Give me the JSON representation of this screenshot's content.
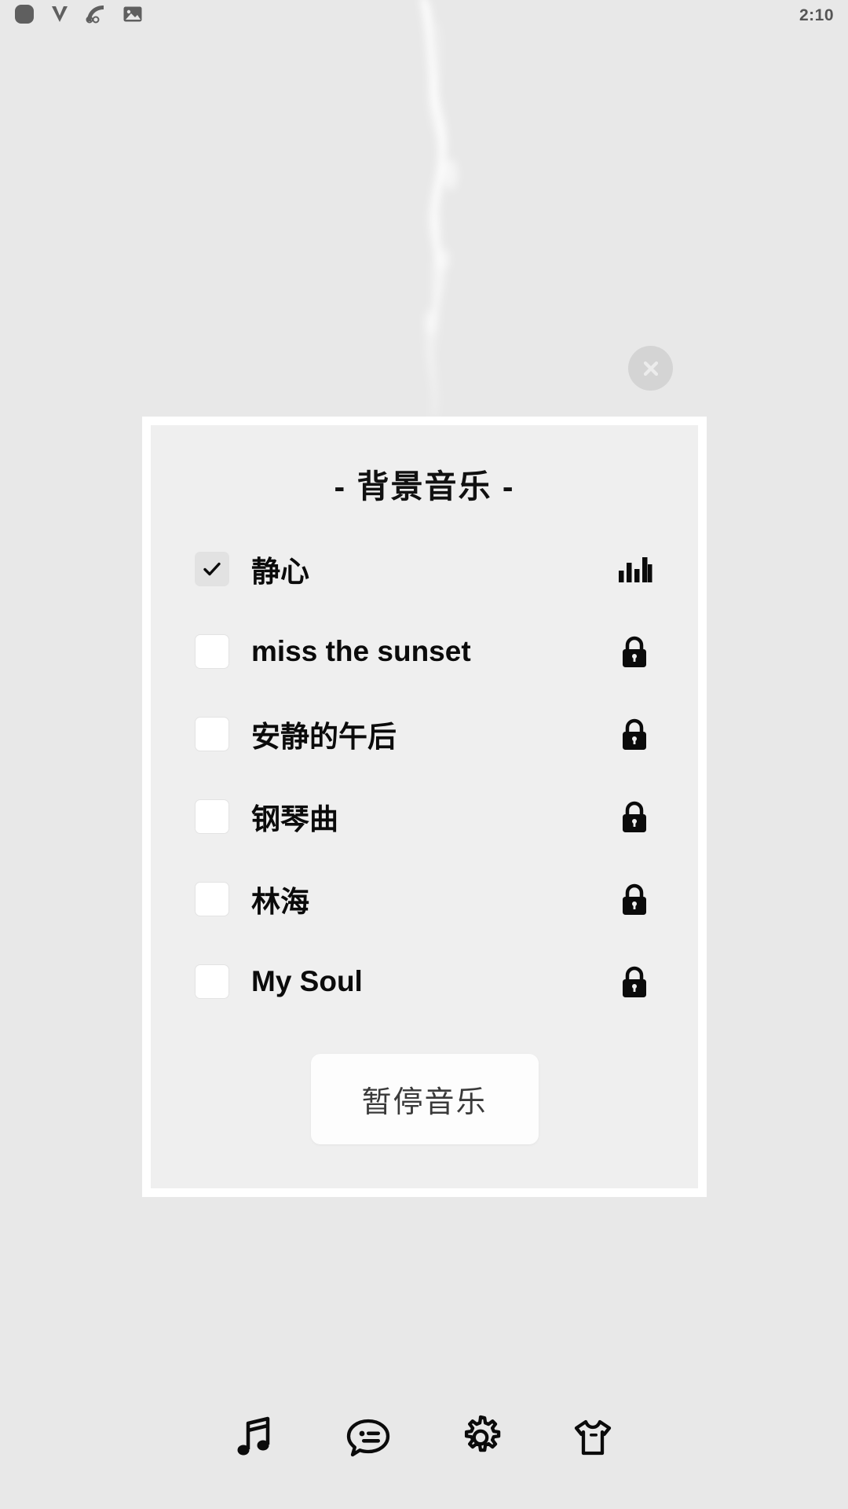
{
  "status_bar": {
    "time": "2:10",
    "icons": [
      {
        "name": "rounded-square-icon",
        "glyph": "rounded-square"
      },
      {
        "name": "v-letter-icon",
        "glyph": "V"
      },
      {
        "name": "satellite-dish-icon",
        "glyph": "dish"
      },
      {
        "name": "photo-icon",
        "glyph": "photo"
      }
    ]
  },
  "close_button": {
    "label": "关闭",
    "icon": "close-icon",
    "bg_color": "#d4d4d4",
    "glyph_color": "#ececec"
  },
  "dialog": {
    "title": "- 背景音乐 -",
    "border_color": "#ffffff",
    "panel_color": "#efefef",
    "tracks": [
      {
        "label": "静心",
        "checked": true,
        "status_icon": "equalizer-icon",
        "locked": false
      },
      {
        "label": "miss the sunset",
        "checked": false,
        "status_icon": "lock-icon",
        "locked": true
      },
      {
        "label": "安静的午后",
        "checked": false,
        "status_icon": "lock-icon",
        "locked": true
      },
      {
        "label": "钢琴曲",
        "checked": false,
        "status_icon": "lock-icon",
        "locked": true
      },
      {
        "label": "林海",
        "checked": false,
        "status_icon": "lock-icon",
        "locked": true
      },
      {
        "label": "My Soul",
        "checked": false,
        "status_icon": "lock-icon",
        "locked": true
      }
    ],
    "action_button": {
      "label": "暂停音乐",
      "bg_color": "#fdfdfd",
      "text_color": "#3a3a3a"
    }
  },
  "bottom_nav": [
    {
      "name": "nav-music",
      "icon": "music-note-icon"
    },
    {
      "name": "nav-chat",
      "icon": "chat-bubble-icon"
    },
    {
      "name": "nav-settings",
      "icon": "gear-icon"
    },
    {
      "name": "nav-wardrobe",
      "icon": "tshirt-icon"
    }
  ],
  "theme": {
    "page_bg": "#e8e8e8",
    "text_color": "#0b0b0b",
    "icon_color": "#000000"
  }
}
